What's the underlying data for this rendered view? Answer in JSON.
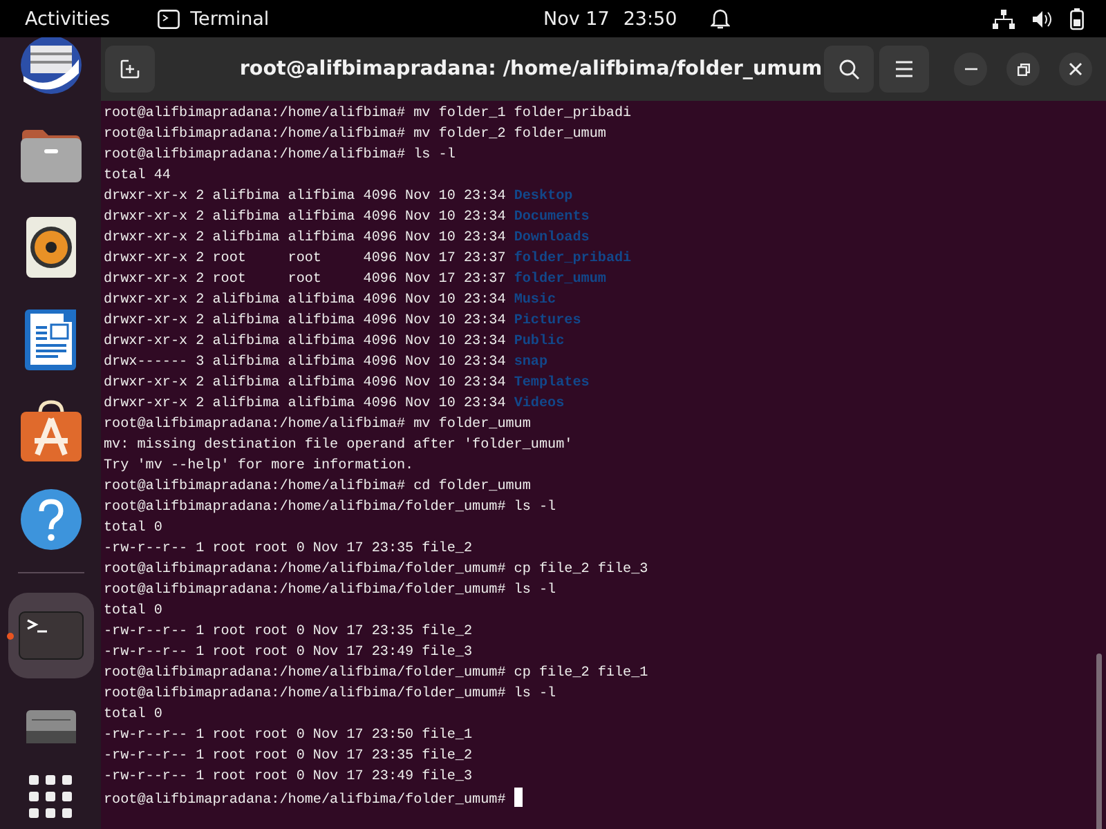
{
  "top_bar": {
    "activities": "Activities",
    "app_name": "Terminal",
    "date": "Nov 17",
    "time": "23:50"
  },
  "dock": {
    "items": [
      {
        "kind": "mail",
        "active": false
      },
      {
        "kind": "files",
        "active": false
      },
      {
        "kind": "music",
        "active": false
      },
      {
        "kind": "writer",
        "active": false
      },
      {
        "kind": "software",
        "active": false
      },
      {
        "kind": "help",
        "active": false
      },
      {
        "kind": "separator"
      },
      {
        "kind": "terminal",
        "active": true
      },
      {
        "kind": "drive",
        "active": false
      },
      {
        "kind": "apps",
        "active": false
      }
    ]
  },
  "window": {
    "title": "root@alifbimapradana: /home/alifbima/folder_umum"
  },
  "terminal": {
    "cursor": true,
    "lines": [
      {
        "kind": "text",
        "text": "root@alifbimapradana:/home/alifbima# mv folder_1 folder_pribadi"
      },
      {
        "kind": "text",
        "text": "root@alifbimapradana:/home/alifbima# mv folder_2 folder_umum"
      },
      {
        "kind": "text",
        "text": "root@alifbimapradana:/home/alifbima# ls -l"
      },
      {
        "kind": "text",
        "text": "total 44"
      },
      {
        "kind": "entry",
        "text": "drwxr-xr-x 2 alifbima alifbima 4096 Nov 10 23:34 ",
        "name": "Desktop"
      },
      {
        "kind": "entry",
        "text": "drwxr-xr-x 2 alifbima alifbima 4096 Nov 10 23:34 ",
        "name": "Documents"
      },
      {
        "kind": "entry",
        "text": "drwxr-xr-x 2 alifbima alifbima 4096 Nov 10 23:34 ",
        "name": "Downloads"
      },
      {
        "kind": "entry",
        "text": "drwxr-xr-x 2 root     root     4096 Nov 17 23:37 ",
        "name": "folder_pribadi"
      },
      {
        "kind": "entry",
        "text": "drwxr-xr-x 2 root     root     4096 Nov 17 23:37 ",
        "name": "folder_umum"
      },
      {
        "kind": "entry",
        "text": "drwxr-xr-x 2 alifbima alifbima 4096 Nov 10 23:34 ",
        "name": "Music"
      },
      {
        "kind": "entry",
        "text": "drwxr-xr-x 2 alifbima alifbima 4096 Nov 10 23:34 ",
        "name": "Pictures"
      },
      {
        "kind": "entry",
        "text": "drwxr-xr-x 2 alifbima alifbima 4096 Nov 10 23:34 ",
        "name": "Public"
      },
      {
        "kind": "entry",
        "text": "drwx------ 3 alifbima alifbima 4096 Nov 10 23:34 ",
        "name": "snap"
      },
      {
        "kind": "entry",
        "text": "drwxr-xr-x 2 alifbima alifbima 4096 Nov 10 23:34 ",
        "name": "Templates"
      },
      {
        "kind": "entry",
        "text": "drwxr-xr-x 2 alifbima alifbima 4096 Nov 10 23:34 ",
        "name": "Videos"
      },
      {
        "kind": "text",
        "text": "root@alifbimapradana:/home/alifbima# mv folder_umum"
      },
      {
        "kind": "text",
        "text": "mv: missing destination file operand after 'folder_umum'"
      },
      {
        "kind": "text",
        "text": "Try 'mv --help' for more information."
      },
      {
        "kind": "text",
        "text": "root@alifbimapradana:/home/alifbima# cd folder_umum"
      },
      {
        "kind": "text",
        "text": "root@alifbimapradana:/home/alifbima/folder_umum# ls -l"
      },
      {
        "kind": "text",
        "text": "total 0"
      },
      {
        "kind": "text",
        "text": "-rw-r--r-- 1 root root 0 Nov 17 23:35 file_2"
      },
      {
        "kind": "text",
        "text": "root@alifbimapradana:/home/alifbima/folder_umum# cp file_2 file_3"
      },
      {
        "kind": "text",
        "text": "root@alifbimapradana:/home/alifbima/folder_umum# ls -l"
      },
      {
        "kind": "text",
        "text": "total 0"
      },
      {
        "kind": "text",
        "text": "-rw-r--r-- 1 root root 0 Nov 17 23:35 file_2"
      },
      {
        "kind": "text",
        "text": "-rw-r--r-- 1 root root 0 Nov 17 23:49 file_3"
      },
      {
        "kind": "text",
        "text": "root@alifbimapradana:/home/alifbima/folder_umum# cp file_2 file_1"
      },
      {
        "kind": "text",
        "text": "root@alifbimapradana:/home/alifbima/folder_umum# ls -l"
      },
      {
        "kind": "text",
        "text": "total 0"
      },
      {
        "kind": "text",
        "text": "-rw-r--r-- 1 root root 0 Nov 17 23:50 file_1"
      },
      {
        "kind": "text",
        "text": "-rw-r--r-- 1 root root 0 Nov 17 23:35 file_2"
      },
      {
        "kind": "text",
        "text": "-rw-r--r-- 1 root root 0 Nov 17 23:49 file_3"
      },
      {
        "kind": "text",
        "text": "root@alifbimapradana:/home/alifbima/folder_umum# "
      }
    ]
  }
}
